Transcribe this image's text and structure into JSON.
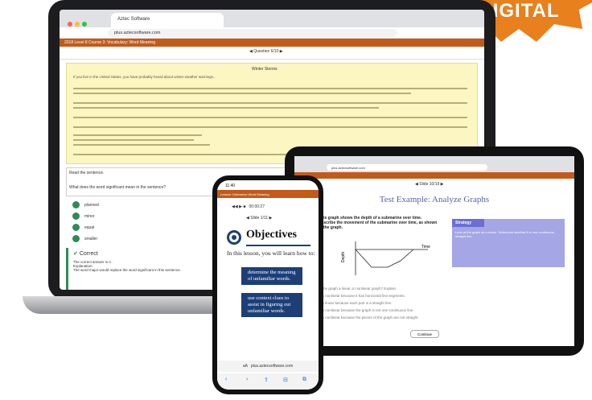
{
  "badge": {
    "label": "DIGITAL",
    "color": "#e8801e"
  },
  "brand": {
    "accent": "#c45a18",
    "objectives_blue": "#1c3f77"
  },
  "laptop": {
    "tab_title": "Aztec Software",
    "url": "plus.aztecsoftware.com",
    "course_bar": "2018 Level 8 Course 3: Vocabulary: Word Meaning",
    "question_nav": "Question 6/10",
    "passage_title": "Winter Storms",
    "passage_intro": "If you live in the United States, you have probably heard about winter weather warnings...",
    "question_line1": "Read the sentence.",
    "question_line2": "What does the word significant mean in the sentence?",
    "answers": [
      {
        "label": "planned"
      },
      {
        "label": "minor"
      },
      {
        "label": "equal"
      },
      {
        "label": "smaller"
      }
    ],
    "feedback_title": "Correct",
    "feedback_lines": [
      "The correct answer is C.",
      "Explanation:",
      "The word major would replace the word significant in this sentence."
    ]
  },
  "tablet": {
    "url": "plus.aztecsoftware.com",
    "slide_nav": "Slide 10/19",
    "title": "Test Example: Analyze Graphs",
    "question": "This graph shows the depth of a submarine over time. Describe the movement of the submarine over time, as shown in the graph.",
    "strategy_label": "Strategy",
    "strategy_text": "Look at the graph as a whole. Determine whether it is one continuous, straight line.",
    "graph_ylabel": "Depth",
    "graph_xlabel": "Time",
    "options": [
      "Is the graph a linear or nonlinear graph? Explain.",
      "It is nonlinear because it has horizontal line segments.",
      "It is linear because each part is a straight line.",
      "It is nonlinear because the graph is not one continuous line.",
      "It is nonlinear because the pieces of the graph are not straight."
    ],
    "continue_label": "Continue"
  },
  "phone": {
    "status_time": "11:40",
    "course_bar": "Lesson: Determine Word Meaning",
    "audio_time": "00:00:27",
    "slide_nav": "Slide 1/11",
    "objectives_title": "Objectives",
    "intro_text": "In this lesson, you will learn how to:",
    "objectives": [
      "determine the meaning of unfamiliar words.",
      "use context clues to assist in figuring out unfamiliar words."
    ],
    "url": "plus.aztecsoftware.com",
    "url_prefix": "aA"
  }
}
